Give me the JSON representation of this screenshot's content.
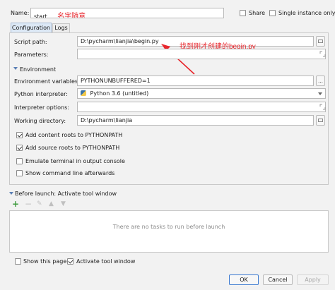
{
  "header": {
    "name_label": "Name:",
    "name_value": "start",
    "name_annotation": "名字随意",
    "share_label": "Share",
    "single_instance_label": "Single instance only"
  },
  "tabs": [
    {
      "label": "Configuration"
    },
    {
      "label": "Logs"
    }
  ],
  "config": {
    "script_path_label": "Script path:",
    "script_path_value": "D:\\pycharm\\lianjia\\begin.py",
    "script_annotation": "找到刚才创建的begin.py",
    "parameters_label": "Parameters:",
    "environment_section": "Environment",
    "env_vars_label": "Environment variables:",
    "env_vars_value": "PYTHONUNBUFFERED=1",
    "interpreter_label": "Python interpreter:",
    "interpreter_value": "Python 3.6 (untitled)",
    "interpreter_options_label": "Interpreter options:",
    "working_dir_label": "Working directory:",
    "working_dir_value": "D:\\pycharm\\lianjia",
    "checkboxes": [
      {
        "label": "Add content roots to PYTHONPATH",
        "checked": true
      },
      {
        "label": "Add source roots to PYTHONPATH",
        "checked": true
      },
      {
        "label": "Emulate terminal in output console",
        "checked": false
      },
      {
        "label": "Show command line afterwards",
        "checked": false
      }
    ]
  },
  "before_launch": {
    "title": "Before launch: Activate tool window",
    "empty_text": "There are no tasks to run before launch"
  },
  "footer": {
    "show_page_label": "Show this page",
    "activate_tool_label": "Activate tool window",
    "ok_label": "OK",
    "cancel_label": "Cancel",
    "apply_label": "Apply"
  },
  "colors": {
    "annotation": "#e8262c",
    "selected_tab": "#dce8f5"
  }
}
